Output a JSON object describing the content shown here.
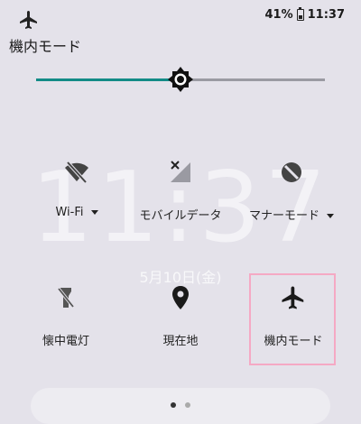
{
  "status": {
    "battery": "41%",
    "time": "11:37"
  },
  "header": {
    "title": "機内モード"
  },
  "brightness": {
    "level_fraction": 0.5
  },
  "background": {
    "time": "11:37",
    "date": "5月10日(金)"
  },
  "tiles": [
    {
      "label": "Wi-Fi",
      "icon": "wifi-off-icon"
    },
    {
      "label": "モバイルデータ",
      "icon": "mobile-data-off-icon"
    },
    {
      "label": "マナーモード",
      "icon": "do-not-disturb-icon"
    },
    {
      "label": "懐中電灯",
      "icon": "flashlight-off-icon"
    },
    {
      "label": "現在地",
      "icon": "location-icon"
    },
    {
      "label": "機内モード",
      "icon": "airplane-icon"
    }
  ],
  "colors": {
    "accent": "#138b87",
    "highlight": "#f5a9c4"
  }
}
